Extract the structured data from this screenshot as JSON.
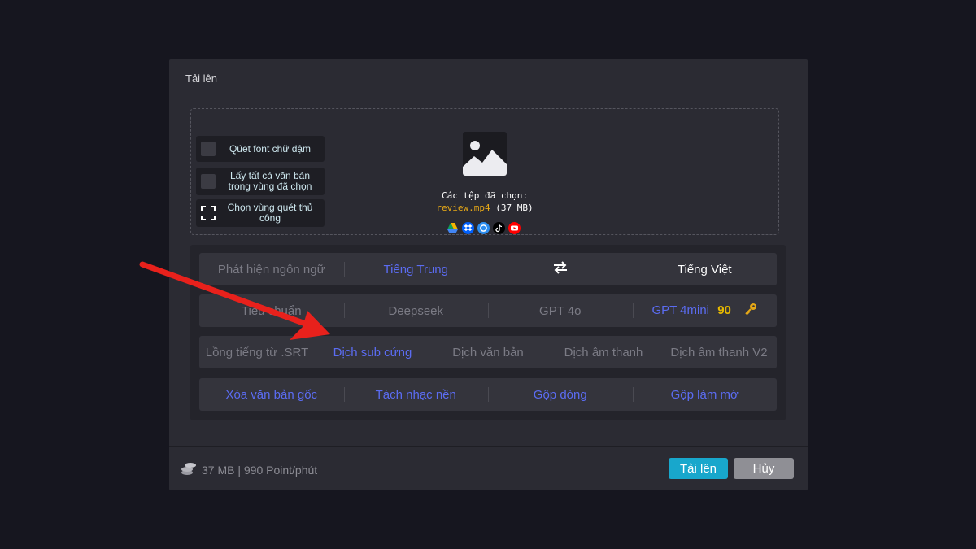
{
  "dialog": {
    "title": "Tải lên"
  },
  "options": [
    {
      "label": "Qúet font chữ đậm"
    },
    {
      "label": "Lấy tất cả văn bản trong vùng đã chọn"
    },
    {
      "label": "Chọn vùng quét thủ công"
    }
  ],
  "dropzone": {
    "selected_label": "Các tệp đã chọn:",
    "file_name": "review.mp4",
    "file_size": "(37 MB)",
    "sources": [
      "google-drive-icon",
      "dropbox-icon",
      "onedrive-icon",
      "tiktok-icon",
      "youtube-icon"
    ]
  },
  "language": {
    "detect": "Phát hiện ngôn ngữ",
    "source": "Tiếng Trung",
    "target": "Tiếng Việt"
  },
  "models": {
    "standard": "Tiêu chuẩn",
    "deepseek": "Deepseek",
    "gpt4o": "GPT 4o",
    "gpt4mini": "GPT 4mini",
    "gpt4mini_score": "90"
  },
  "modes": {
    "dub_srt": "Lồng tiếng từ .SRT",
    "hardsub": "Dịch sub cứng",
    "text": "Dịch văn bản",
    "audio": "Dịch âm thanh",
    "audio_v2": "Dịch âm thanh V2"
  },
  "tools": {
    "remove_text": "Xóa văn bản gốc",
    "split_music": "Tách nhạc nền",
    "merge_lines": "Gộp dòng",
    "merge_blur": "Gộp làm mờ"
  },
  "footer": {
    "cost": "37 MB | 990 Point/phút",
    "upload_label": "Tải lên",
    "cancel_label": "Hủy"
  },
  "colors": {
    "accent_blue": "#5b6cf2",
    "gold": "#e6a817",
    "upload_button": "#18a7cc",
    "arrow": "#e8211c"
  }
}
